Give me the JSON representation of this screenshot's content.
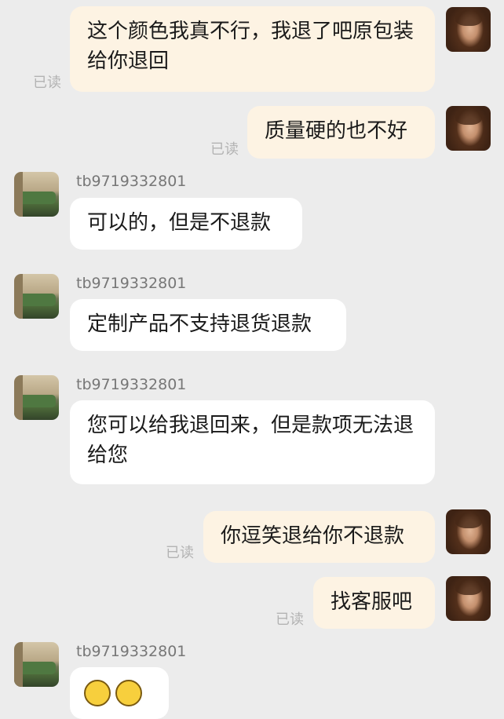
{
  "messages": [
    {
      "side": "me",
      "text": "这个颜色我真不行，我退了吧原包装给你退回",
      "status": "已读"
    },
    {
      "side": "me",
      "text": "质量硬的也不好",
      "status": "已读"
    },
    {
      "side": "other",
      "sender": "tb9719332801",
      "text": "可以的，但是不退款"
    },
    {
      "side": "other",
      "sender": "tb9719332801",
      "text": "定制产品不支持退货退款"
    },
    {
      "side": "other",
      "sender": "tb9719332801",
      "text": "您可以给我退回来，但是款项无法退给您"
    },
    {
      "side": "me",
      "text": "你逗笑退给你不退款",
      "status": "已读"
    },
    {
      "side": "me",
      "text": "找客服吧",
      "status": "已读"
    },
    {
      "side": "other",
      "sender": "tb9719332801",
      "emoji": [
        "grinning-face-emoji",
        "grinning-face-emoji"
      ]
    }
  ],
  "colors": {
    "background": "#ececec",
    "my_bubble": "#fdf3e3",
    "their_bubble": "#ffffff",
    "read_status": "#b3b3b3",
    "sender_name": "#777777"
  }
}
